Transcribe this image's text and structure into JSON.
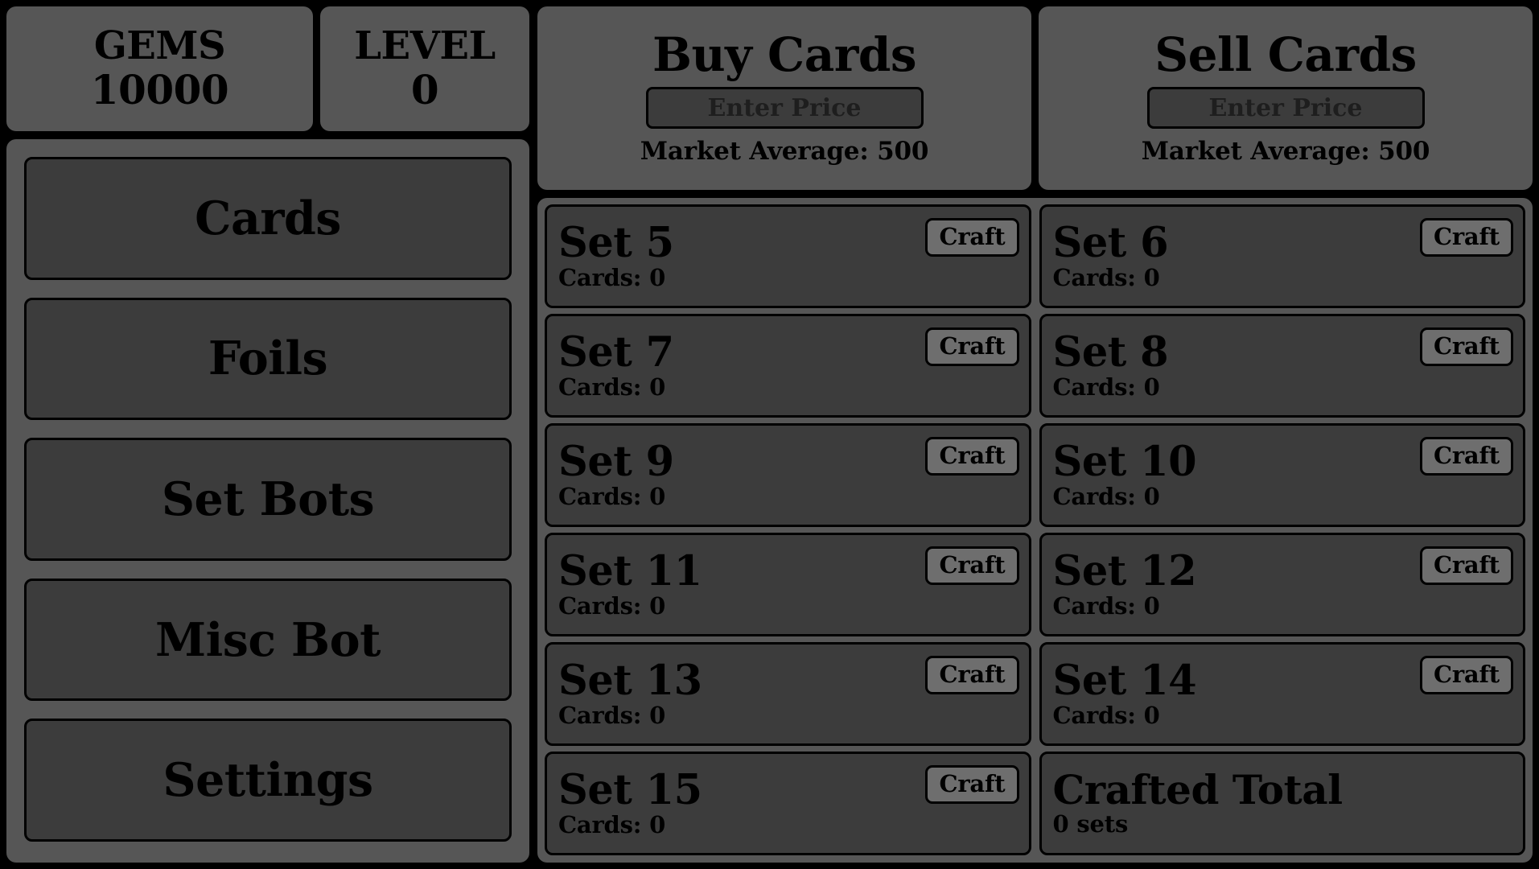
{
  "stats": {
    "gems": {
      "label": "GEMS",
      "value": "10000"
    },
    "level": {
      "label": "LEVEL",
      "value": "0"
    }
  },
  "sidebar": {
    "items": [
      {
        "label": "Cards"
      },
      {
        "label": "Foils"
      },
      {
        "label": "Set Bots"
      },
      {
        "label": "Misc Bot"
      },
      {
        "label": "Settings"
      }
    ]
  },
  "trade": {
    "buy": {
      "title": "Buy Cards",
      "input_value": "",
      "input_placeholder": "Enter Price",
      "market_average": "Market Average: 500"
    },
    "sell": {
      "title": "Sell Cards",
      "input_value": "",
      "input_placeholder": "Enter Price",
      "market_average": "Market Average: 500"
    }
  },
  "sets": {
    "craft_label": "Craft",
    "items": [
      {
        "name": "Set 5",
        "cards": "Cards: 0"
      },
      {
        "name": "Set 6",
        "cards": "Cards: 0"
      },
      {
        "name": "Set 7",
        "cards": "Cards: 0"
      },
      {
        "name": "Set 8",
        "cards": "Cards: 0"
      },
      {
        "name": "Set 9",
        "cards": "Cards: 0"
      },
      {
        "name": "Set 10",
        "cards": "Cards: 0"
      },
      {
        "name": "Set 11",
        "cards": "Cards: 0"
      },
      {
        "name": "Set 12",
        "cards": "Cards: 0"
      },
      {
        "name": "Set 13",
        "cards": "Cards: 0"
      },
      {
        "name": "Set 14",
        "cards": "Cards: 0"
      },
      {
        "name": "Set 15",
        "cards": "Cards: 0"
      }
    ],
    "total": {
      "name": "Crafted Total",
      "value": "0 sets"
    }
  },
  "colors": {
    "background": "#000000",
    "panel": "#565656",
    "card": "#3c3c3c",
    "button_light": "#6e6e6e",
    "text": "#000000",
    "placeholder": "#1e1e1e"
  }
}
